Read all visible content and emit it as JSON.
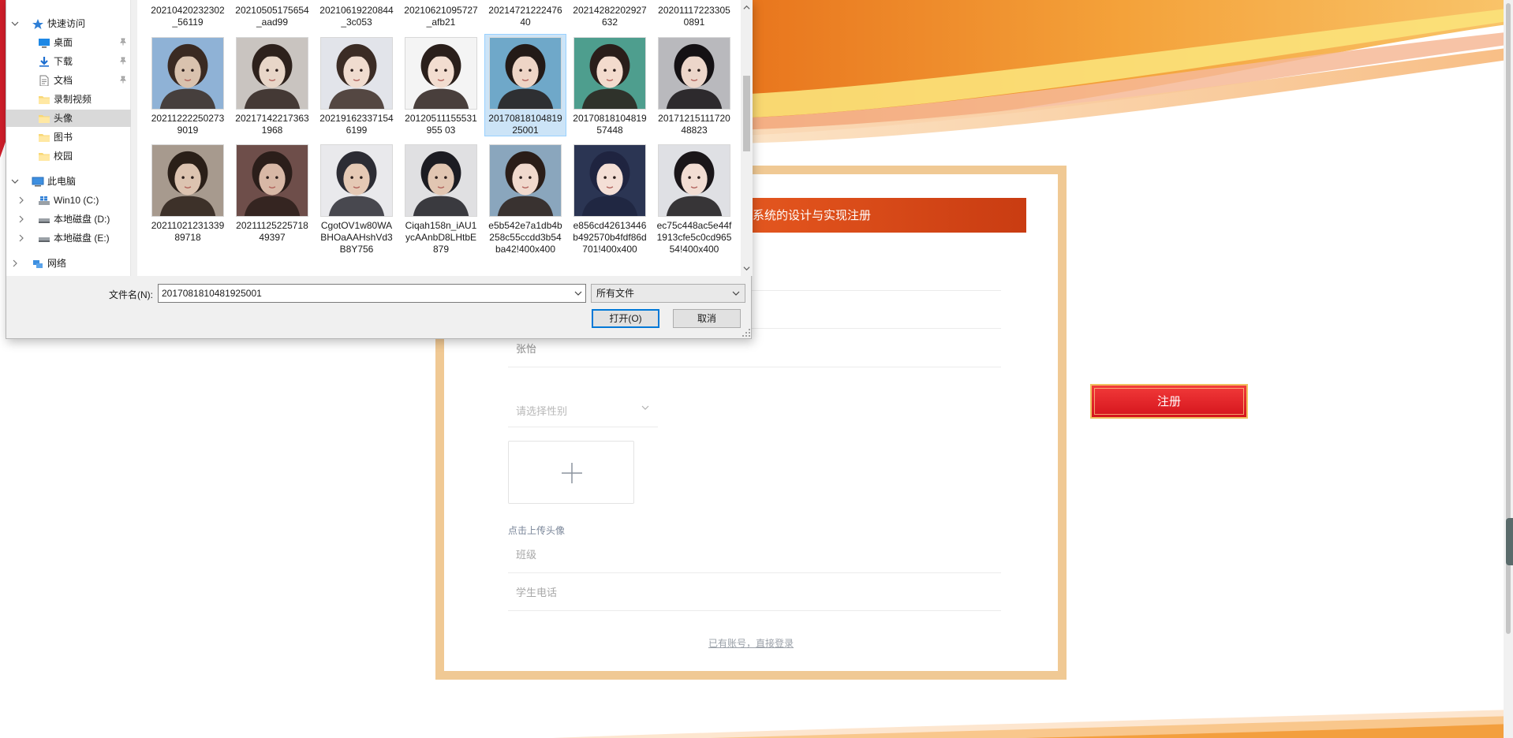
{
  "dialog": {
    "nav": [
      {
        "label": "快速访问",
        "icon": "star-icon",
        "level": 0,
        "expanded": true
      },
      {
        "label": "桌面",
        "icon": "desktop-icon",
        "level": 1,
        "pinned": true
      },
      {
        "label": "下载",
        "icon": "download-arrow-icon",
        "level": 1,
        "pinned": true
      },
      {
        "label": "文档",
        "icon": "document-icon",
        "level": 1,
        "pinned": true
      },
      {
        "label": "录制视频",
        "icon": "folder-icon",
        "level": 1
      },
      {
        "label": "头像",
        "icon": "folder-icon",
        "level": 1,
        "selected": true
      },
      {
        "label": "图书",
        "icon": "folder-icon",
        "level": 1
      },
      {
        "label": "校园",
        "icon": "folder-icon",
        "level": 1
      },
      {
        "label": "此电脑",
        "icon": "computer-icon",
        "level": 0,
        "expanded": true
      },
      {
        "label": "Win10 (C:)",
        "icon": "windows-drive-icon",
        "level": 1,
        "expandable": true
      },
      {
        "label": "本地磁盘 (D:)",
        "icon": "drive-icon",
        "level": 1,
        "expandable": true
      },
      {
        "label": "本地磁盘 (E:)",
        "icon": "drive-icon",
        "level": 1,
        "expandable": true
      },
      {
        "label": "网络",
        "icon": "network-icon",
        "level": 0,
        "expandable": true
      }
    ],
    "top_row_names": [
      "20210420232302_56119",
      "20210505175654_aad99",
      "20210619220844_3c053",
      "20210621095727_afb21",
      "2021472122247640",
      "20214282202927632",
      "2020111722330508​91"
    ],
    "files_row1": [
      {
        "name": "202112222502739019",
        "palette": [
          "#8fb2d6",
          "#d9c2ae",
          "#3a2a22"
        ]
      },
      {
        "name": "202171422173631968",
        "palette": [
          "#c9c4c0",
          "#e8d6c8",
          "#2d211c"
        ]
      },
      {
        "name": "202191623371546199",
        "palette": [
          "#e2e4ea",
          "#f0dccf",
          "#3b2c25"
        ]
      },
      {
        "name": "20120511155531955 03",
        "palette": [
          "#f4f4f4",
          "#f2ddd0",
          "#2a1f1b"
        ]
      },
      {
        "name": "2017081810481925001",
        "palette": [
          "#6fa8c9",
          "#eed5c6",
          "#231a17"
        ],
        "selected": true
      },
      {
        "name": "2017081810481957448",
        "palette": [
          "#4e9e8e",
          "#f3dbcd",
          "#2a1e1a"
        ]
      },
      {
        "name": "2017121511172048823",
        "palette": [
          "#b9b9bd",
          "#ecd6ca",
          "#141114"
        ]
      }
    ],
    "files_row2": [
      {
        "name": "2021102123133989718",
        "palette": [
          "#a79a8e",
          "#dcc3b0",
          "#2a1f18"
        ]
      },
      {
        "name": "2021112522571849397",
        "palette": [
          "#6e4e4a",
          "#d8b8a6",
          "#2b1e1a"
        ]
      },
      {
        "name": "CgotOV1w80WABHOaAAHshVd3B8Y756",
        "palette": [
          "#e9e9ec",
          "#e5c9b5",
          "#2c2c34"
        ]
      },
      {
        "name": "Ciqah158n_iAU1ycAAnbD8LHtbE879",
        "palette": [
          "#e0e0e2",
          "#e1c6b2",
          "#1c1c22"
        ]
      },
      {
        "name": "e5b542e7a1db4b258c55ccdd3b54ba42!400x400",
        "palette": [
          "#8aa6bd",
          "#f0d9cd",
          "#2a1d18"
        ]
      },
      {
        "name": "e856cd42613446b492570b4fdf86d701!400x400",
        "palette": [
          "#2b3553",
          "#f4dfd6",
          "#1f2440"
        ]
      },
      {
        "name": "ec75c448ac5e44f1913cfe5c0cd96554!400x400",
        "palette": [
          "#dfe0e4",
          "#f2ddd3",
          "#1a1619"
        ]
      }
    ],
    "filename_label": "文件名(N):",
    "filename_value": "2017081810481925001",
    "filetype_value": "所有文件",
    "open_label": "打开(O)",
    "cancel_label": "取消"
  },
  "form": {
    "header_title": "系统的设计与实现注册",
    "name_value": "张怡",
    "gender_placeholder": "请选择性别",
    "upload_label": "点击上传头像",
    "class_placeholder": "班级",
    "phone_placeholder": "学生电话",
    "login_link": "已有账号，直接登录",
    "register_label": "注册"
  },
  "colors": {
    "accent_orange": "#e0521c",
    "card_border": "#f0c994",
    "register_red": "#d4141c",
    "dialog_focus_blue": "#0078d7",
    "selection_blue": "#cce4f7"
  }
}
